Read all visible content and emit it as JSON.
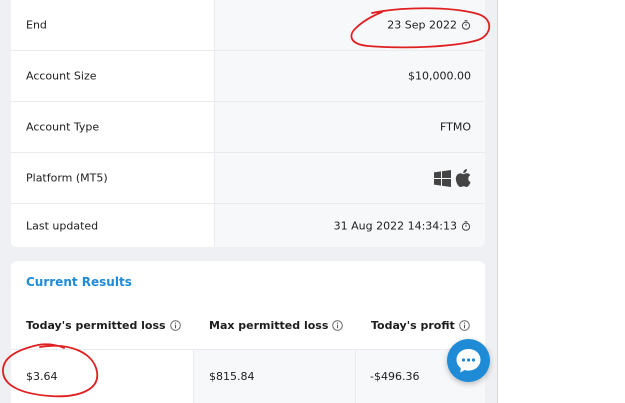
{
  "details": {
    "rows": [
      {
        "label": "End",
        "value": "23 Sep 2022",
        "icon": "clock-icon"
      },
      {
        "label": "Account Size",
        "value": "$10,000.00"
      },
      {
        "label": "Account Type",
        "value": "FTMO"
      },
      {
        "label": "Platform (MT5)",
        "icons": [
          "windows-icon",
          "apple-icon"
        ]
      },
      {
        "label": "Last updated",
        "value": "31 Aug 2022 14:34:13",
        "icon": "clock-icon"
      }
    ]
  },
  "current_results": {
    "title": "Current Results",
    "columns": [
      {
        "label": "Today's permitted loss",
        "value": "$3.64"
      },
      {
        "label": "Max permitted loss",
        "value": "$815.84"
      },
      {
        "label": "Today's profit",
        "value": "-$496.36"
      }
    ]
  },
  "chat": {
    "icon": "chat-bubble-icon"
  },
  "colors": {
    "accent": "#1f8ad6",
    "annotation": "#e02020",
    "page_bg": "#eef0f3"
  }
}
